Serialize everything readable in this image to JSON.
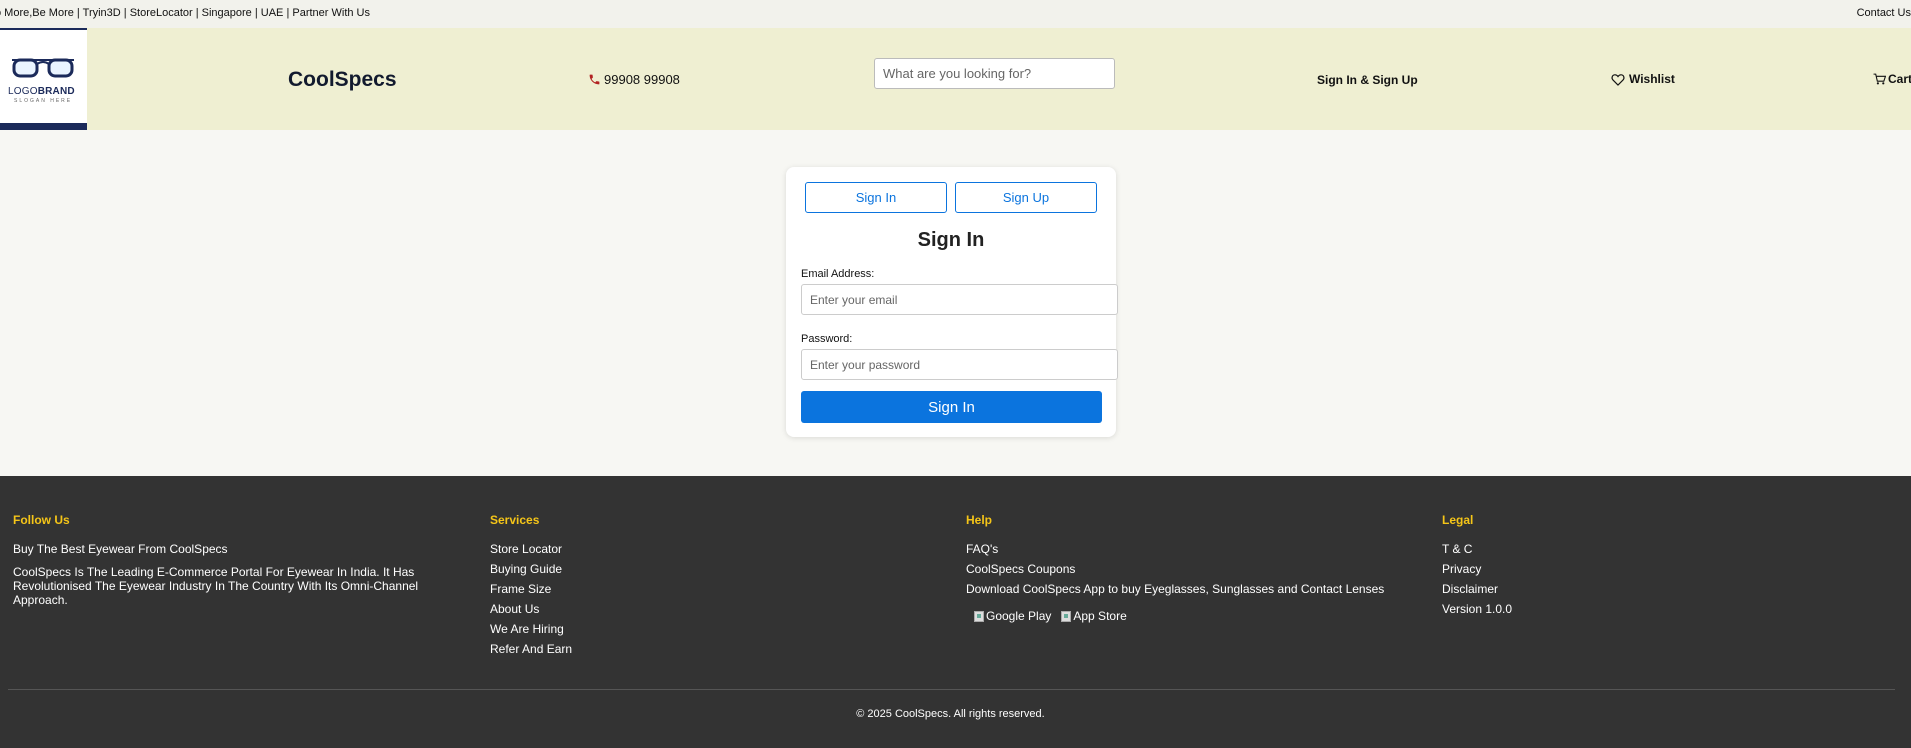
{
  "topbar": {
    "left_text": "o More,Be More | Tryin3D | StoreLocator | Singapore | UAE | Partner With Us",
    "contact": "Contact Us"
  },
  "header": {
    "logo_brand_a": "LOGO",
    "logo_brand_b": "BRAND",
    "logo_tagline": "SLOGAN HERE",
    "site_name": "CoolSpecs",
    "phone": "99908 99908",
    "search_placeholder": "What are you looking for?",
    "signin_link": "Sign In & Sign Up",
    "wishlist": "Wishlist",
    "cart": "Cart",
    "icons": {
      "phone": "phone-icon",
      "wishlist": "heart-icon",
      "cart": "cart-icon"
    }
  },
  "auth": {
    "tabs": [
      {
        "label": "Sign In"
      },
      {
        "label": "Sign Up"
      }
    ],
    "title": "Sign In",
    "email_label": "Email Address:",
    "email_placeholder": "Enter your email",
    "password_label": "Password:",
    "password_placeholder": "Enter your password",
    "submit_label": "Sign In"
  },
  "footer": {
    "follow": {
      "heading": "Follow Us",
      "tagline": "Buy The Best Eyewear From CoolSpecs",
      "description": "CoolSpecs Is The Leading E-Commerce Portal For Eyewear In India. It Has Revolutionised The Eyewear Industry In The Country With Its Omni-Channel Approach."
    },
    "services": {
      "heading": "Services",
      "links": [
        "Store Locator",
        "Buying Guide",
        "Frame Size",
        "About Us",
        "We Are Hiring",
        "Refer And Earn"
      ]
    },
    "help": {
      "heading": "Help",
      "links": [
        "FAQ's",
        "CoolSpecs Coupons",
        "Download CoolSpecs App to buy Eyeglasses, Sunglasses and Contact Lenses"
      ],
      "apps": [
        "Google Play",
        "App Store"
      ]
    },
    "legal": {
      "heading": "Legal",
      "links": [
        "T & C",
        "Privacy",
        "Disclaimer",
        "Version 1.0.0"
      ]
    },
    "copyright": "© 2025 CoolSpecs. All rights reserved."
  },
  "colors": {
    "header_bg": "#efefd2",
    "accent_blue": "#0b74de",
    "footer_bg": "#333333",
    "footer_heading": "#f5c518"
  }
}
